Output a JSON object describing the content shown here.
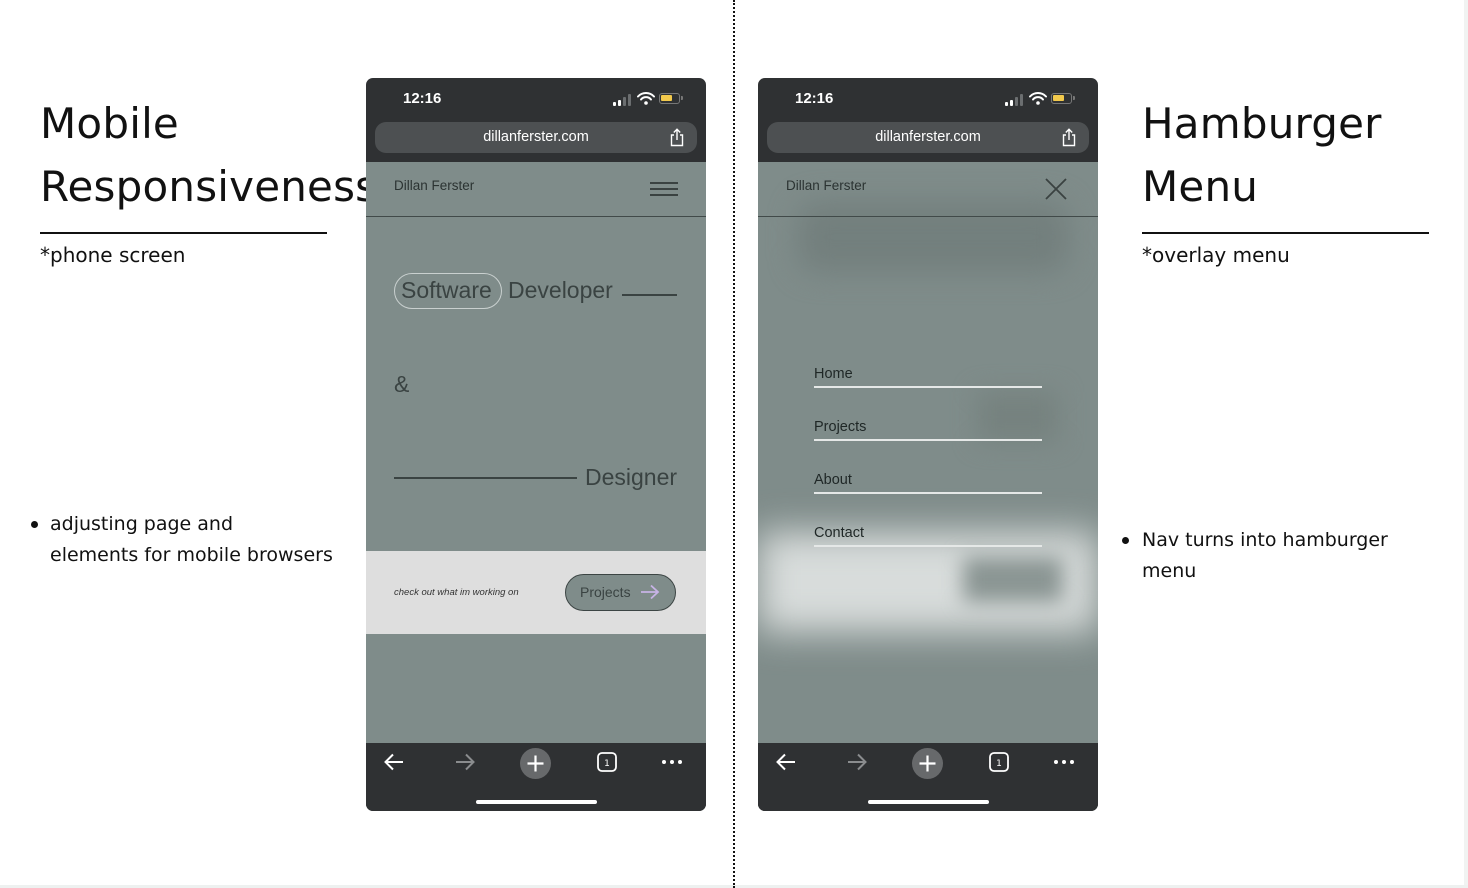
{
  "left": {
    "heading_line1": "Mobile",
    "heading_line2": "Responsiveness",
    "note": "*phone screen",
    "bullet_line1": "adjusting page and",
    "bullet_line2": "elements for mobile browsers"
  },
  "right": {
    "heading_line1": "Hamburger",
    "heading_line2": "Menu",
    "note": "*overlay menu",
    "bullet": "Nav turns into hamburger menu"
  },
  "phone": {
    "time": "12:16",
    "url": "dillanferster.com",
    "site_name": "Dillan Ferster",
    "toolbar_tabs_count": "1",
    "battery_color": "#f2c94c",
    "page_bg": "#7f8c8a"
  },
  "hero": {
    "word1": "Software",
    "word2": "Developer",
    "amp": "&",
    "word3": "Designer"
  },
  "cta": {
    "text": "check out what im working on",
    "button_label": "Projects"
  },
  "menu": {
    "items": [
      "Home",
      "Projects",
      "About",
      "Contact"
    ]
  }
}
